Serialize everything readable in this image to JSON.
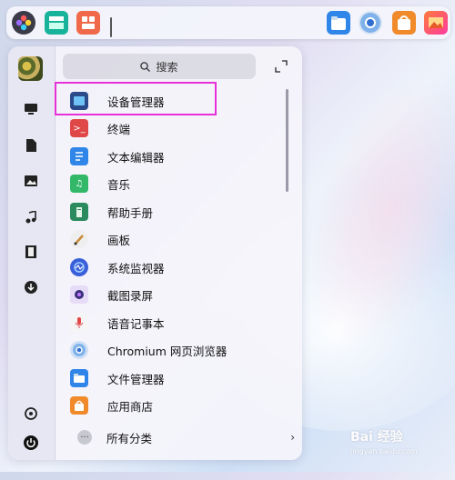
{
  "search": {
    "label": "搜索"
  },
  "apps": [
    {
      "label": "设备管理器",
      "icon": "device-manager-icon",
      "color": "#2a7fd8"
    },
    {
      "label": "终端",
      "icon": "terminal-icon",
      "color": "#e04848"
    },
    {
      "label": "文本编辑器",
      "icon": "text-editor-icon",
      "color": "#2f86e8"
    },
    {
      "label": "音乐",
      "icon": "music-icon",
      "color": "#33b86a"
    },
    {
      "label": "帮助手册",
      "icon": "help-manual-icon",
      "color": "#2b8a5e"
    },
    {
      "label": "画板",
      "icon": "drawing-board-icon",
      "color": "#d9d9d9"
    },
    {
      "label": "系统监视器",
      "icon": "system-monitor-icon",
      "color": "#3a5fd9"
    },
    {
      "label": "截图录屏",
      "icon": "screenshot-icon",
      "color": "#7a5fd8"
    },
    {
      "label": "语音记事本",
      "icon": "voice-notes-icon",
      "color": "#f0f0f0"
    },
    {
      "label": "Chromium 网页浏览器",
      "icon": "chromium-icon",
      "color": "#4a8fe0"
    },
    {
      "label": "文件管理器",
      "icon": "file-manager-icon",
      "color": "#2f86e8"
    },
    {
      "label": "应用商店",
      "icon": "app-store-icon",
      "color": "#f08a2a"
    }
  ],
  "footer": {
    "label": "所有分类",
    "arrow": "›"
  },
  "watermark": {
    "text": "Bai 经验",
    "sub": "jingyan.baidu.com"
  }
}
